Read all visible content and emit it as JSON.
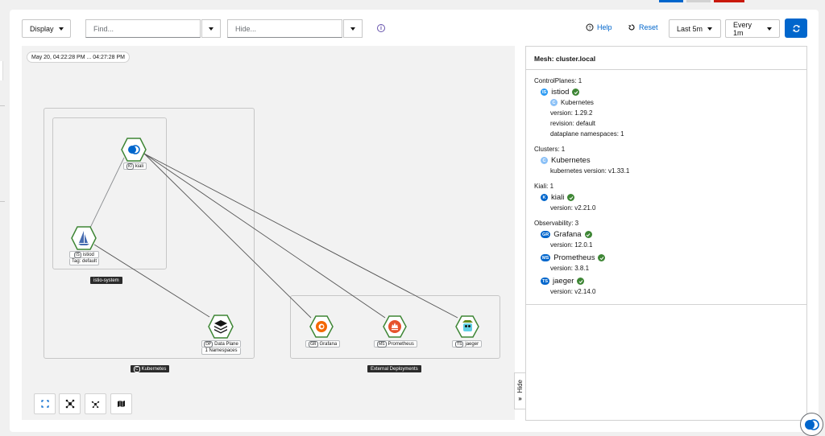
{
  "toolbar": {
    "display_label": "Display",
    "find_placeholder": "Find...",
    "hide_placeholder": "Hide...",
    "help_label": "Help",
    "reset_label": "Reset",
    "duration_label": "Last 5m",
    "refresh_interval_label": "Every 1m"
  },
  "graph": {
    "time_range": "May 20, 04:22:28 PM ... 04:27:28 PM",
    "boxes": {
      "kubernetes": {
        "badge": "C",
        "label": "Kubernetes"
      },
      "istio_system": {
        "label": "istio-system"
      },
      "external": {
        "label": "External Deployments"
      }
    },
    "nodes": {
      "kiali": {
        "badge": "KI",
        "label": "kiali"
      },
      "istiod": {
        "badge": "IS",
        "label": "istiod",
        "sublabel": "Tag: default"
      },
      "dataplane": {
        "badge": "DP",
        "label": "Data Plane",
        "sublabel": "1 Namespaces"
      },
      "grafana": {
        "badge": "GR",
        "label": "Grafana"
      },
      "prometheus": {
        "badge": "MS",
        "label": "Prometheus"
      },
      "jaeger": {
        "badge": "TS",
        "label": "jaeger"
      }
    },
    "hide_label": "Hide"
  },
  "panel": {
    "title": "Mesh: cluster.local",
    "control_planes": {
      "header": "ControlPlanes: 1",
      "name": "istiod",
      "badge": "IS",
      "cluster_badge": "C",
      "cluster": "Kubernetes",
      "version": "version: 1.29.2",
      "revision": "revision: default",
      "namespaces": "dataplane namespaces: 1"
    },
    "clusters": {
      "header": "Clusters: 1",
      "badge": "C",
      "name": "Kubernetes",
      "version": "kubernetes version: v1.33.1"
    },
    "kiali": {
      "header": "Kiali: 1",
      "badge": "K",
      "name": "kiali",
      "version": "version: v2.21.0"
    },
    "observability": {
      "header": "Observability: 3",
      "items": [
        {
          "badge": "GR",
          "name": "Grafana",
          "version": "version: 12.0.1"
        },
        {
          "badge": "MS",
          "name": "Prometheus",
          "version": "version: 3.8.1"
        },
        {
          "badge": "TS",
          "name": "jaeger",
          "version": "version: v2.14.0"
        }
      ]
    }
  },
  "colors": {
    "primary": "#0066cc",
    "success": "#3e8635",
    "badge_blue": "#2b9af3",
    "badge_cluster": "#8bc1f7",
    "badge_dark_blue": "#06c"
  },
  "icons": {
    "help": "question-circle-icon",
    "reset": "undo-icon",
    "refresh": "sync-icon"
  }
}
